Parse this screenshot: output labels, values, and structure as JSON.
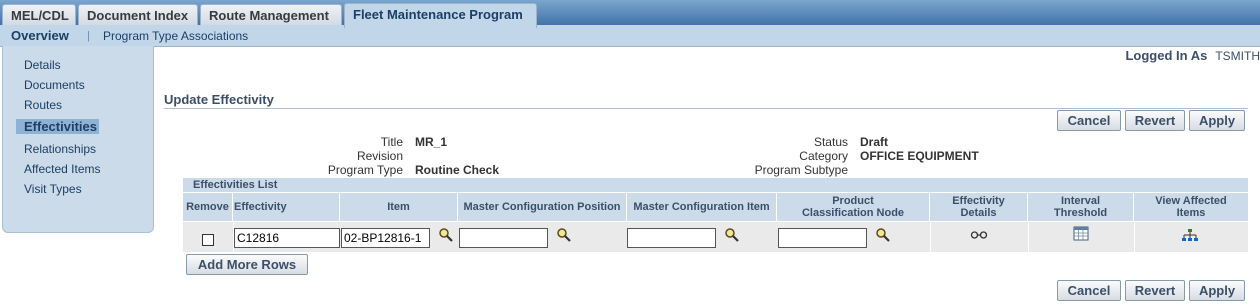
{
  "tabs": [
    {
      "label": "MEL/CDL"
    },
    {
      "label": "Document Index"
    },
    {
      "label": "Route Management"
    },
    {
      "label": "Fleet Maintenance Program"
    }
  ],
  "subnav": {
    "overview": "Overview",
    "separator": "|",
    "program_type_assoc": "Program Type Associations"
  },
  "leftnav": {
    "items": [
      {
        "label": "Details"
      },
      {
        "label": "Documents"
      },
      {
        "label": "Routes"
      },
      {
        "label": "Effectivities"
      },
      {
        "label": "Relationships"
      },
      {
        "label": "Affected Items"
      },
      {
        "label": "Visit Types"
      }
    ]
  },
  "user": {
    "label": "Logged In As",
    "name": "TSMITH"
  },
  "page": {
    "title": "Update Effectivity"
  },
  "buttons": {
    "cancel": "Cancel",
    "revert": "Revert",
    "apply": "Apply",
    "add_rows": "Add More Rows"
  },
  "header": {
    "title_label": "Title",
    "title_value": "MR_1",
    "revision_label": "Revision",
    "revision_value": "",
    "program_type_label": "Program Type",
    "program_type_value": "Routine Check",
    "status_label": "Status",
    "status_value": "Draft",
    "category_label": "Category",
    "category_value": "OFFICE EQUIPMENT",
    "program_subtype_label": "Program Subtype",
    "program_subtype_value": ""
  },
  "list": {
    "heading": "Effectivities List",
    "columns": {
      "remove": "Remove",
      "effectivity": "Effectivity",
      "item": "Item",
      "mc_position": "Master Configuration Position",
      "mc_item": "Master Configuration Item",
      "pc_node": "Product Classification Node",
      "eff_details": "Effectivity Details",
      "interval": "Interval Threshold",
      "view_affected": "View Affected Items"
    },
    "row": {
      "effectivity": "C12816",
      "item": "02-BP12816-1",
      "mc_position": "",
      "mc_item": "",
      "pc_node": ""
    }
  },
  "icons": {
    "search": "search-icon",
    "details": "glasses-icon",
    "interval": "calendar-icon",
    "view": "hierarchy-icon"
  }
}
